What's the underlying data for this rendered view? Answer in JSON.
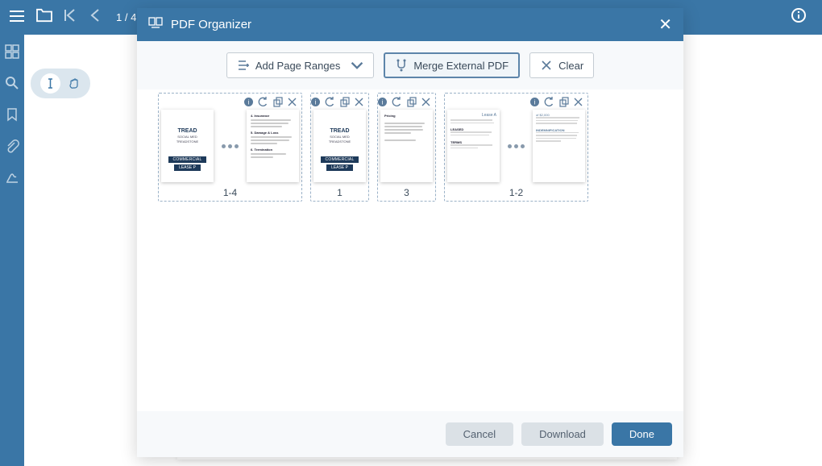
{
  "toolbar": {
    "page_indicator": "1 / 4"
  },
  "modal": {
    "title": "PDF Organizer",
    "buttons": {
      "add_ranges": "Add Page Ranges",
      "merge": "Merge External PDF",
      "clear": "Clear"
    },
    "groups": [
      {
        "label": "1-4",
        "thumbnails": [
          "cover",
          "doc"
        ],
        "dots": true
      },
      {
        "label": "1",
        "thumbnails": [
          "cover"
        ],
        "dots": false
      },
      {
        "label": "3",
        "thumbnails": [
          "pricing"
        ],
        "dots": false
      },
      {
        "label": "1-2",
        "thumbnails": [
          "lease1",
          "lease2"
        ],
        "dots": true
      }
    ],
    "thumb_text": {
      "brand": "TREAD",
      "sub": "SOCIAL MED",
      "sub2": "TREADSTONE",
      "tag": "COMMERCIAL",
      "tag2": "LEASE P",
      "pricing_title": "Pricing",
      "lease_title": "Lease A"
    },
    "footer": {
      "cancel": "Cancel",
      "download": "Download",
      "done": "Done"
    }
  }
}
